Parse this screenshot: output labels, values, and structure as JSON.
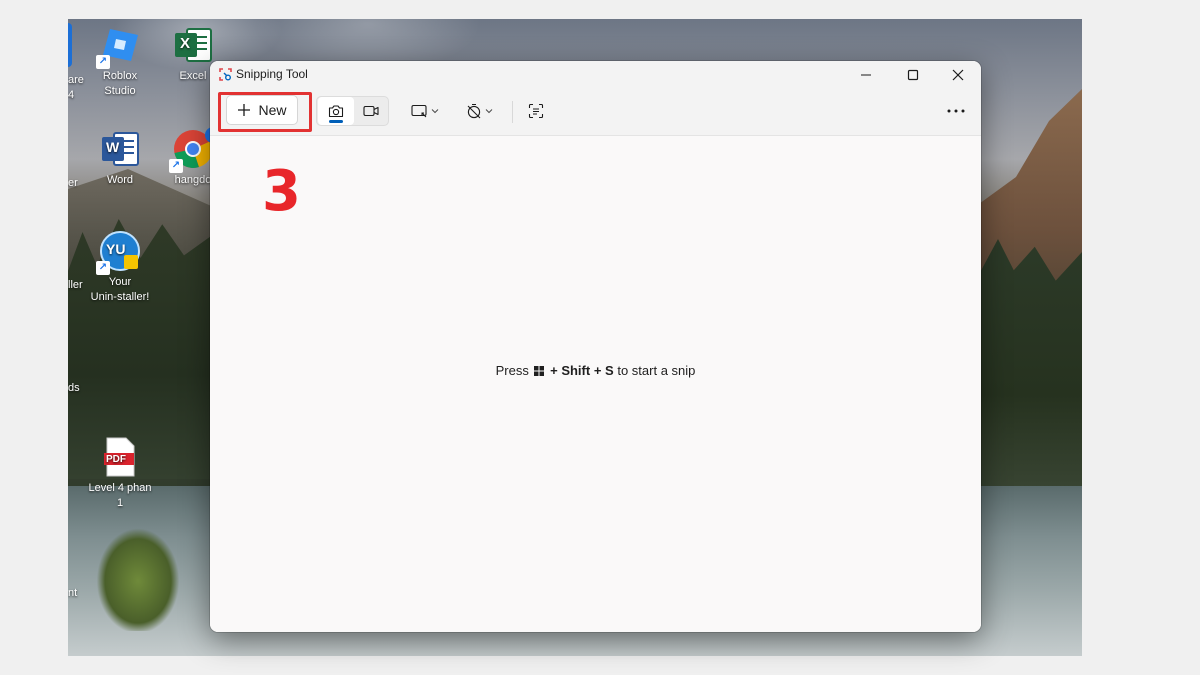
{
  "desktop": {
    "icons": [
      {
        "id": "roblox",
        "label_lines": [
          "Roblox",
          "Studio"
        ]
      },
      {
        "id": "excel",
        "label_lines": [
          "Excel"
        ]
      },
      {
        "id": "word",
        "label_lines": [
          "Word"
        ]
      },
      {
        "id": "chrome",
        "label_lines": [
          "hangdo"
        ]
      },
      {
        "id": "uninstaller",
        "label_lines": [
          "Your",
          "Unin-staller!"
        ]
      },
      {
        "id": "pdf",
        "label_lines": [
          "Level 4 phan",
          "1"
        ]
      }
    ],
    "partial_labels": [
      "are",
      "4",
      "er",
      "ller",
      "ds",
      "nt"
    ],
    "excel_glyph": "X",
    "word_glyph": "W",
    "pdf_glyph": "PDF",
    "chrome_badge": "H",
    "uninstaller_glyph": "YU"
  },
  "annotation": {
    "step_number": "3",
    "color": "#e8262a"
  },
  "window": {
    "title": "Snipping Tool",
    "controls": [
      "minimize-icon",
      "maximize-icon",
      "close-icon"
    ],
    "toolbar": {
      "new_label": "New",
      "modes": [
        {
          "name": "snip-mode-screenshot",
          "icon": "camera-icon",
          "selected": true
        },
        {
          "name": "snip-mode-video",
          "icon": "video-camera-icon",
          "selected": false
        }
      ],
      "shape_icon": "rectangle-snip-icon",
      "timer_icon": "no-delay-timer-icon",
      "text_actions_icon": "text-actions-icon",
      "more_icon": "more-options-icon"
    },
    "hint": {
      "prefix": "Press",
      "plus1": "+",
      "shift": "Shift",
      "plus2": "+",
      "key": "S",
      "suffix": "to start a snip"
    }
  },
  "colors": {
    "accent": "#005fb8",
    "highlight": "#e23232",
    "excel": "#1d6f42",
    "word": "#2b579a",
    "pdf": "#d9232d"
  }
}
